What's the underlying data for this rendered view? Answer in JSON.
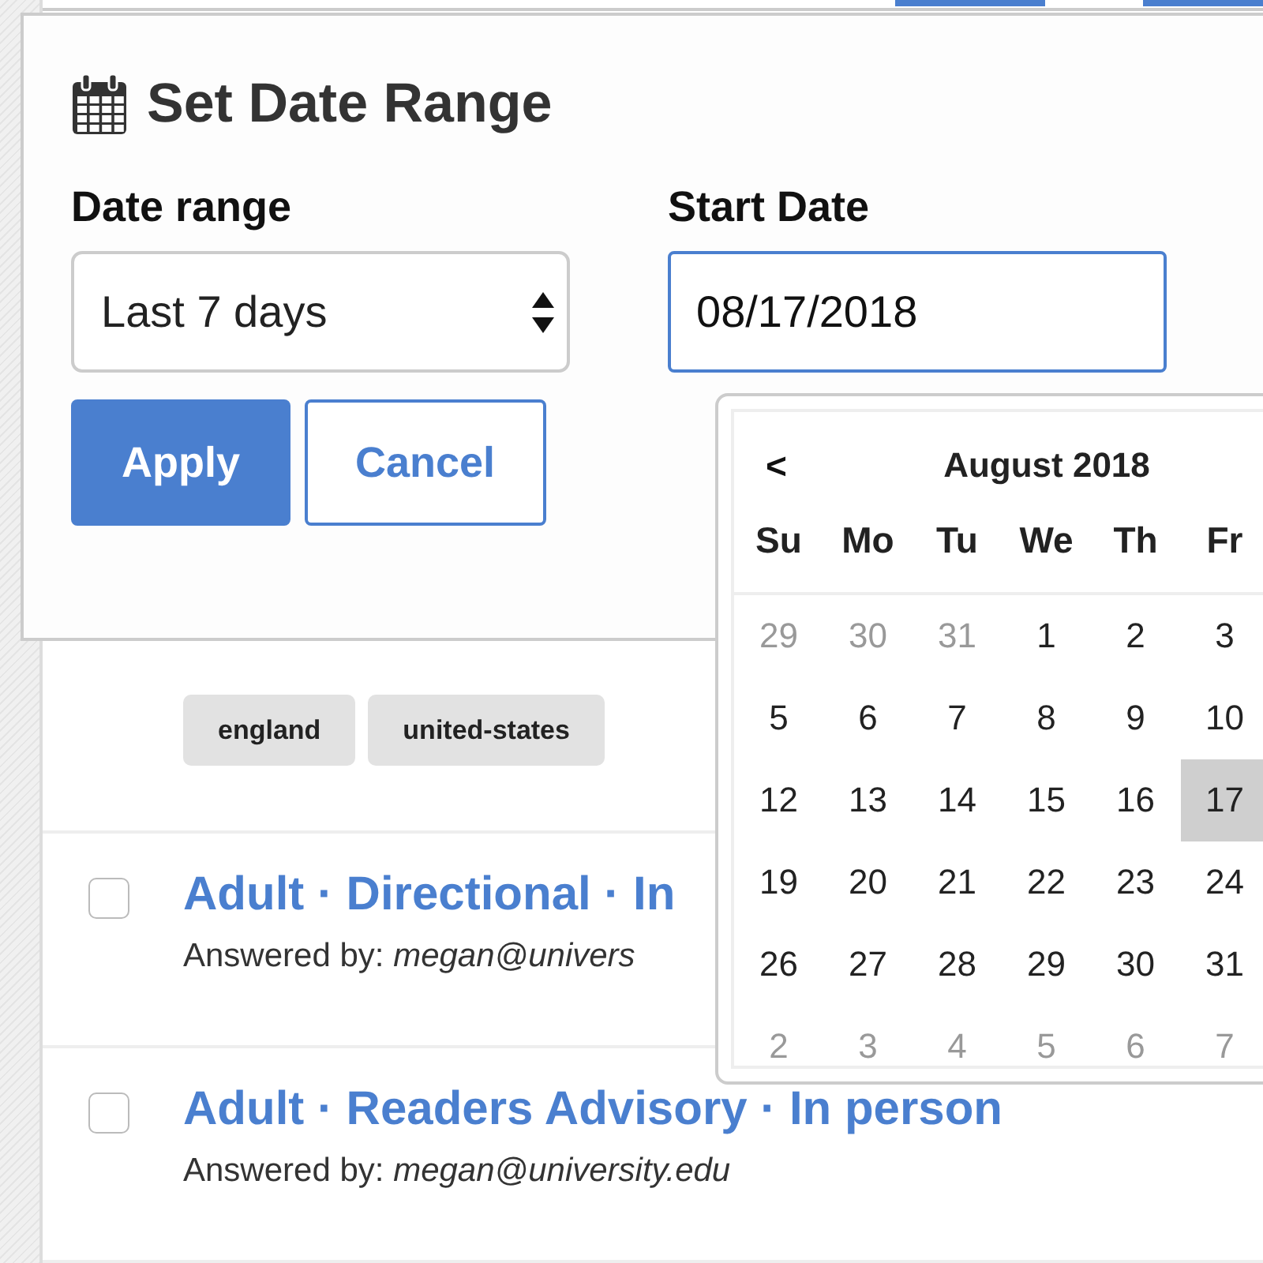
{
  "dialog": {
    "title": "Set Date Range",
    "date_range": {
      "label": "Date range",
      "value": "Last 7 days"
    },
    "start_date": {
      "label": "Start Date",
      "value": "08/17/2018"
    },
    "buttons": [
      {
        "label": "Apply",
        "kind": "primary"
      },
      {
        "label": "Cancel",
        "kind": "secondary"
      }
    ]
  },
  "calendar": {
    "prev": "<",
    "title": "August 2018",
    "weekdays": [
      "Su",
      "Mo",
      "Tu",
      "We",
      "Th",
      "Fr"
    ],
    "weeks": [
      [
        {
          "day": "29",
          "other_month": true,
          "selected": false
        },
        {
          "day": "30",
          "other_month": true,
          "selected": false
        },
        {
          "day": "31",
          "other_month": true,
          "selected": false
        },
        {
          "day": "1",
          "other_month": false,
          "selected": false
        },
        {
          "day": "2",
          "other_month": false,
          "selected": false
        },
        {
          "day": "3",
          "other_month": false,
          "selected": false
        }
      ],
      [
        {
          "day": "5",
          "other_month": false,
          "selected": false
        },
        {
          "day": "6",
          "other_month": false,
          "selected": false
        },
        {
          "day": "7",
          "other_month": false,
          "selected": false
        },
        {
          "day": "8",
          "other_month": false,
          "selected": false
        },
        {
          "day": "9",
          "other_month": false,
          "selected": false
        },
        {
          "day": "10",
          "other_month": false,
          "selected": false
        }
      ],
      [
        {
          "day": "12",
          "other_month": false,
          "selected": false
        },
        {
          "day": "13",
          "other_month": false,
          "selected": false
        },
        {
          "day": "14",
          "other_month": false,
          "selected": false
        },
        {
          "day": "15",
          "other_month": false,
          "selected": false
        },
        {
          "day": "16",
          "other_month": false,
          "selected": false
        },
        {
          "day": "17",
          "other_month": false,
          "selected": true
        }
      ],
      [
        {
          "day": "19",
          "other_month": false,
          "selected": false
        },
        {
          "day": "20",
          "other_month": false,
          "selected": false
        },
        {
          "day": "21",
          "other_month": false,
          "selected": false
        },
        {
          "day": "22",
          "other_month": false,
          "selected": false
        },
        {
          "day": "23",
          "other_month": false,
          "selected": false
        },
        {
          "day": "24",
          "other_month": false,
          "selected": false
        }
      ],
      [
        {
          "day": "26",
          "other_month": false,
          "selected": false
        },
        {
          "day": "27",
          "other_month": false,
          "selected": false
        },
        {
          "day": "28",
          "other_month": false,
          "selected": false
        },
        {
          "day": "29",
          "other_month": false,
          "selected": false
        },
        {
          "day": "30",
          "other_month": false,
          "selected": false
        },
        {
          "day": "31",
          "other_month": false,
          "selected": false
        }
      ],
      [
        {
          "day": "2",
          "other_month": true,
          "selected": false
        },
        {
          "day": "3",
          "other_month": true,
          "selected": false
        },
        {
          "day": "4",
          "other_month": true,
          "selected": false
        },
        {
          "day": "5",
          "other_month": true,
          "selected": false
        },
        {
          "day": "6",
          "other_month": true,
          "selected": false
        },
        {
          "day": "7",
          "other_month": true,
          "selected": false
        }
      ]
    ]
  },
  "tags": [
    "england",
    "united-states"
  ],
  "questions": [
    {
      "title": "Adult · Directional · In",
      "answered_by": "Answered by: *megan@univers*",
      "checked": false
    },
    {
      "title": "Adult · Readers Advisory · In person",
      "answered_by": "Answered by: *megan@university.edu*",
      "checked": false
    }
  ]
}
